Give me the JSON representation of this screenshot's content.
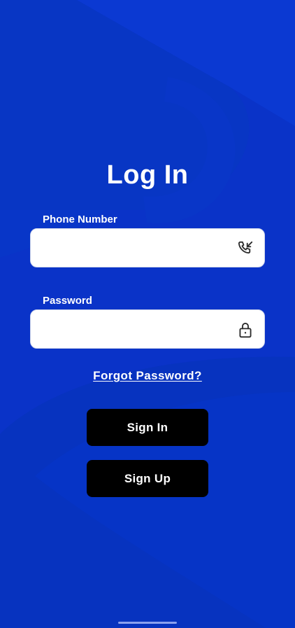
{
  "screen": {
    "title": "Log In",
    "background_color": "#0a33c8"
  },
  "phone": {
    "label": "Phone Number",
    "value": "",
    "placeholder": "",
    "icon": "phone-incoming-icon"
  },
  "password": {
    "label": "Password",
    "value": "",
    "placeholder": "",
    "icon": "lock-icon"
  },
  "forgot_password": {
    "label": "Forgot Password?"
  },
  "buttons": {
    "sign_in": "Sign In",
    "sign_up": "Sign Up",
    "color": "#000000"
  }
}
